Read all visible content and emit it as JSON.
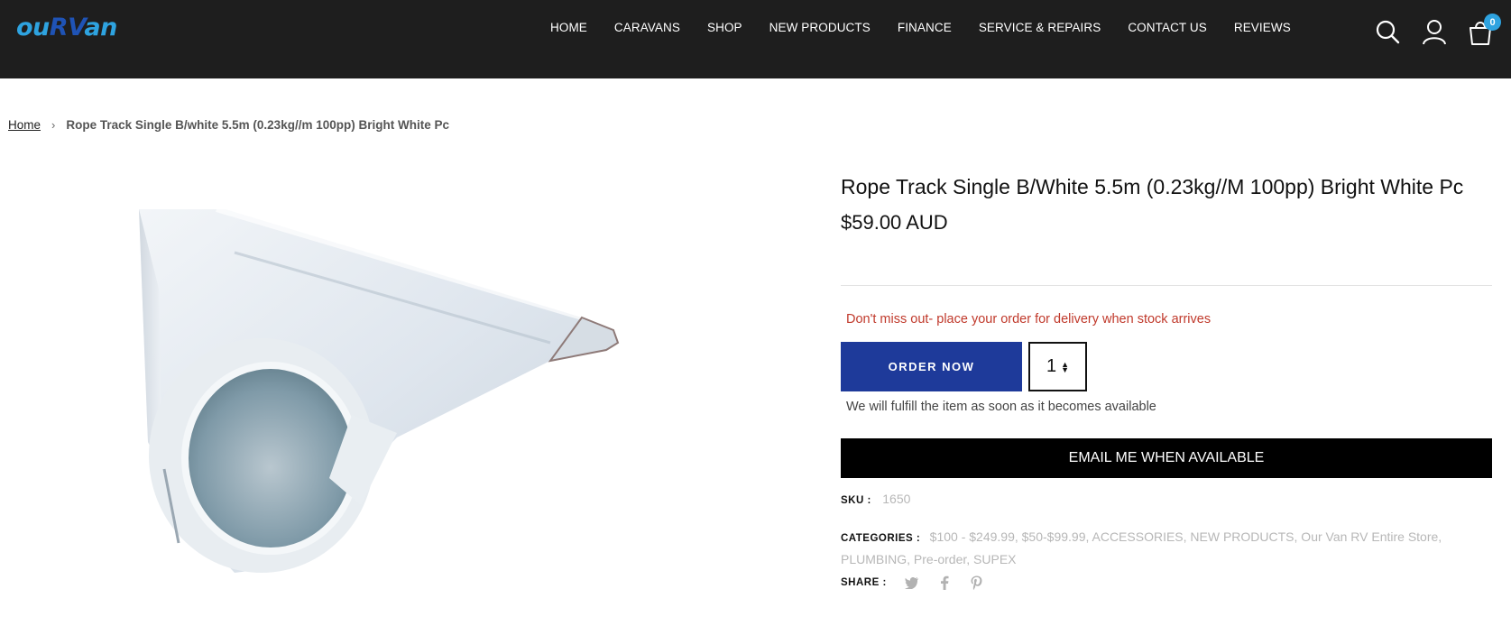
{
  "brand": {
    "logo_part1": "ou",
    "logo_part2": "RV",
    "logo_part3": "an"
  },
  "nav": {
    "items": [
      {
        "label": "HOME"
      },
      {
        "label": "CARAVANS"
      },
      {
        "label": "SHOP"
      },
      {
        "label": "NEW PRODUCTS"
      },
      {
        "label": "FINANCE"
      },
      {
        "label": "SERVICE & REPAIRS"
      },
      {
        "label": "CONTACT US"
      },
      {
        "label": "REVIEWS"
      }
    ]
  },
  "header_icons": {
    "search": "search-icon",
    "account": "user-icon",
    "cart": "cart-icon",
    "cart_count": "0"
  },
  "breadcrumb": {
    "home": "Home",
    "separator": "›",
    "current": "Rope Track Single B/white 5.5m  (0.23kg//m 100pp) Bright White Pc"
  },
  "product": {
    "title": "Rope Track Single B/White 5.5m  (0.23kg//M 100pp) Bright White Pc",
    "price": "$59.00 AUD",
    "stock_notice": "Don't miss out- place your order for delivery when stock arrives",
    "order_button": "ORDER NOW",
    "quantity": "1",
    "fulfill_note": "We will fulfill the item as soon as it becomes available",
    "email_button": "EMAIL ME WHEN AVAILABLE",
    "sku_label": "SKU :",
    "sku": "1650",
    "categories_label": "CATEGORIES :",
    "categories": "$100 - $249.99, $50-$99.99, ACCESSORIES, NEW PRODUCTS, Our Van RV Entire Store, PLUMBING, Pre-order, SUPEX",
    "share_label": "SHARE :"
  },
  "colors": {
    "header_bg": "#1e1e1e",
    "accent_blue": "#1e3a9a",
    "logo_light_blue": "#2ea3e0",
    "notice_red": "#c0392b"
  }
}
